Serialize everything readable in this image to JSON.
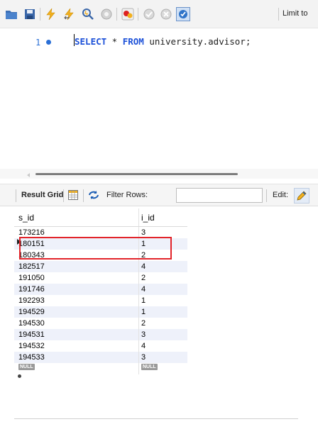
{
  "toolbar": {
    "limit_label": "Limit to",
    "icons": [
      "folder-icon",
      "save-icon",
      "execute-icon",
      "execute-current-icon",
      "explain-icon",
      "stop-icon",
      "toggle-error-icon",
      "commit-icon",
      "rollback-icon",
      "autocommit-icon"
    ]
  },
  "editor": {
    "line_number": "1",
    "sql_keyword_1": "SELECT",
    "sql_part_1": " * ",
    "sql_keyword_2": "FROM",
    "sql_part_2": " university.advisor;"
  },
  "result_toolbar": {
    "result_grid_label": "Result Grid",
    "filter_label": "Filter Rows:",
    "filter_value": "",
    "edit_label": "Edit:"
  },
  "grid": {
    "columns": [
      "s_id",
      "i_id"
    ],
    "rows": [
      [
        "173216",
        "3"
      ],
      [
        "180151",
        "1"
      ],
      [
        "180343",
        "2"
      ],
      [
        "182517",
        "4"
      ],
      [
        "191050",
        "2"
      ],
      [
        "191746",
        "4"
      ],
      [
        "192293",
        "1"
      ],
      [
        "194529",
        "1"
      ],
      [
        "194530",
        "2"
      ],
      [
        "194531",
        "3"
      ],
      [
        "194532",
        "4"
      ],
      [
        "194533",
        "3"
      ]
    ],
    "null_label": "NULL"
  },
  "colors": {
    "keyword": "#1a4fd8",
    "highlight": "#e2242a",
    "alt_row": "#eef1fa"
  }
}
